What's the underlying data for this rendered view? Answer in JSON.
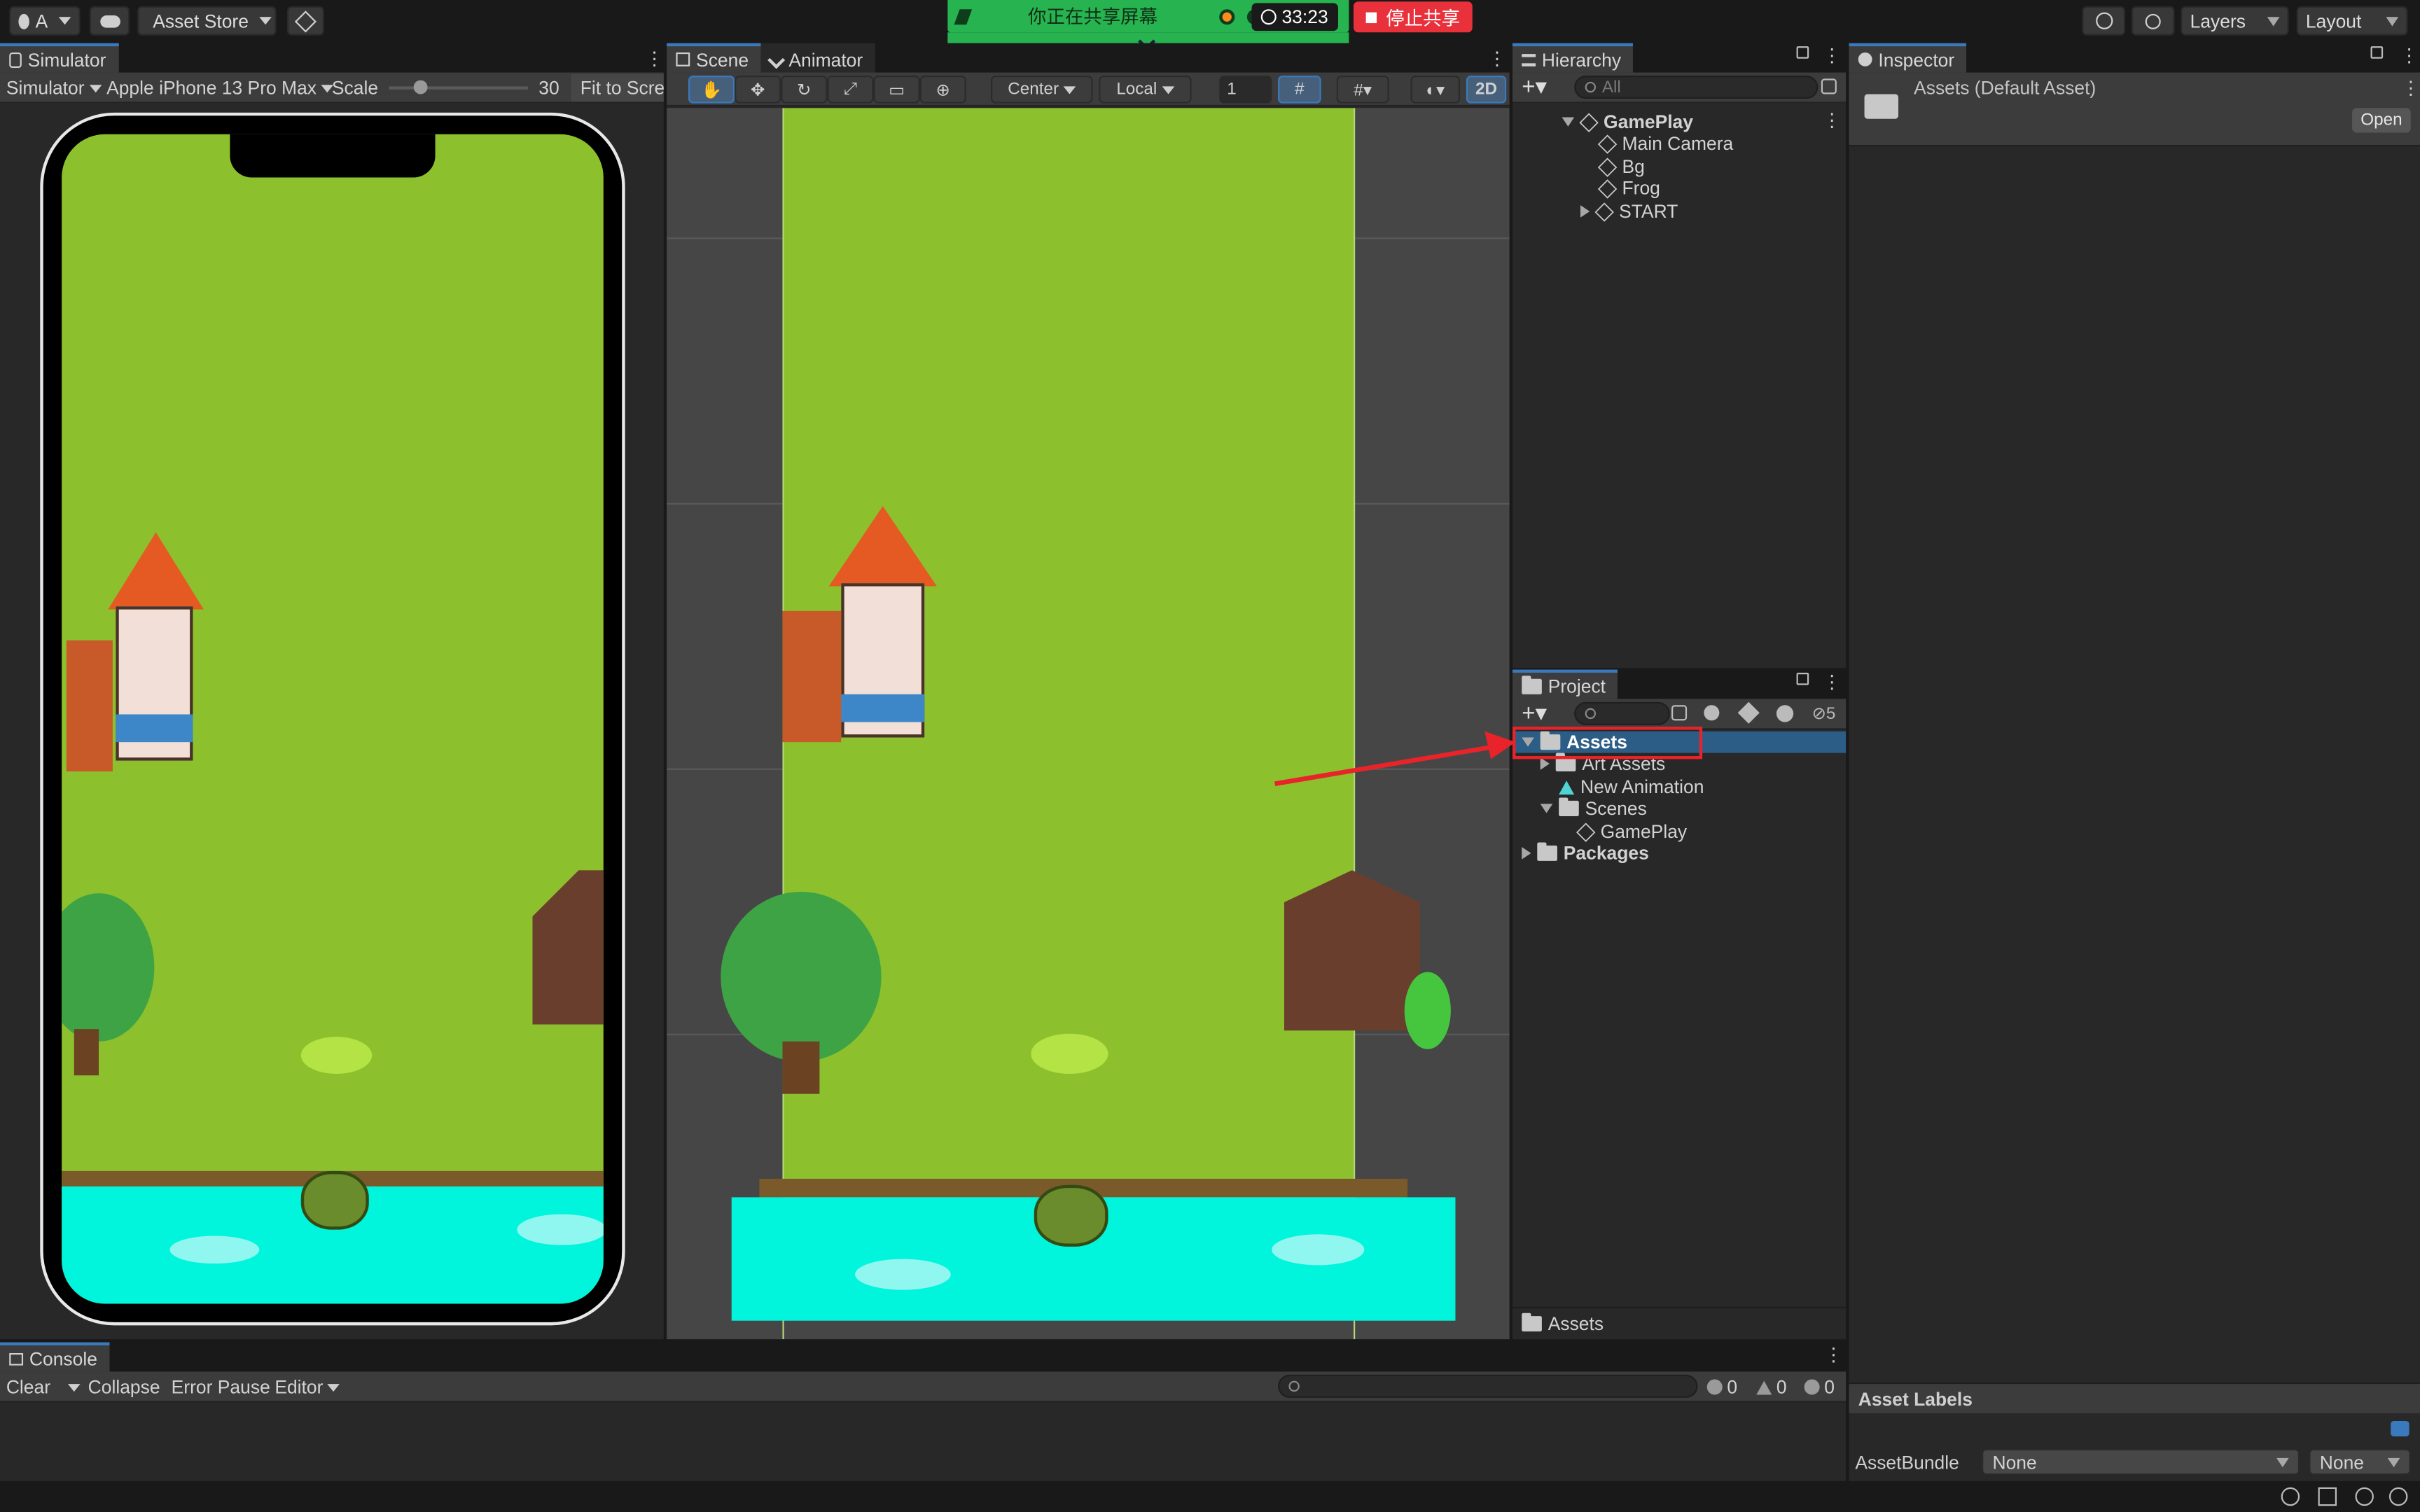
{
  "toolbar": {
    "account": "A",
    "asset_store": "Asset Store",
    "layers": "Layers",
    "layout": "Layout"
  },
  "share": {
    "message": "你正在共享屏幕",
    "timer": "33:23",
    "stop": "停止共享"
  },
  "simulator": {
    "tab": "Simulator",
    "mode": "Simulator",
    "device": "Apple iPhone 13 Pro Max",
    "scale_label": "Scale",
    "scale_value": "30",
    "fit": "Fit to Scre"
  },
  "scene": {
    "tab_scene": "Scene",
    "tab_animator": "Animator",
    "pivot": "Center",
    "space": "Local",
    "grid_value": "1",
    "mode_2d": "2D"
  },
  "hierarchy": {
    "tab": "Hierarchy",
    "search_placeholder": "All",
    "root": "GamePlay",
    "items": [
      "Main Camera",
      "Bg",
      "Frog",
      "START"
    ]
  },
  "project": {
    "tab": "Project",
    "hidden_count": "5",
    "tree": {
      "assets": "Assets",
      "art_assets": "Art Assets",
      "new_animation": "New Animation",
      "scenes": "Scenes",
      "gameplay": "GamePlay",
      "packages": "Packages"
    },
    "footer": "Assets"
  },
  "inspector": {
    "tab": "Inspector",
    "title": "Assets (Default Asset)",
    "open": "Open",
    "asset_labels": "Asset Labels",
    "asset_bundle_label": "AssetBundle",
    "asset_bundle_value": "None",
    "asset_bundle_variant": "None"
  },
  "console": {
    "tab": "Console",
    "clear": "Clear",
    "collapse": "Collapse",
    "error_pause": "Error Pause",
    "editor": "Editor",
    "log_count": "0",
    "warn_count": "0",
    "error_count": "0"
  },
  "colors": {
    "accent": "#3a79bb",
    "grass": "#8cc12d",
    "water": "#00f5dc",
    "highlight_box": "#e8232a",
    "share_green": "#27b34f"
  }
}
